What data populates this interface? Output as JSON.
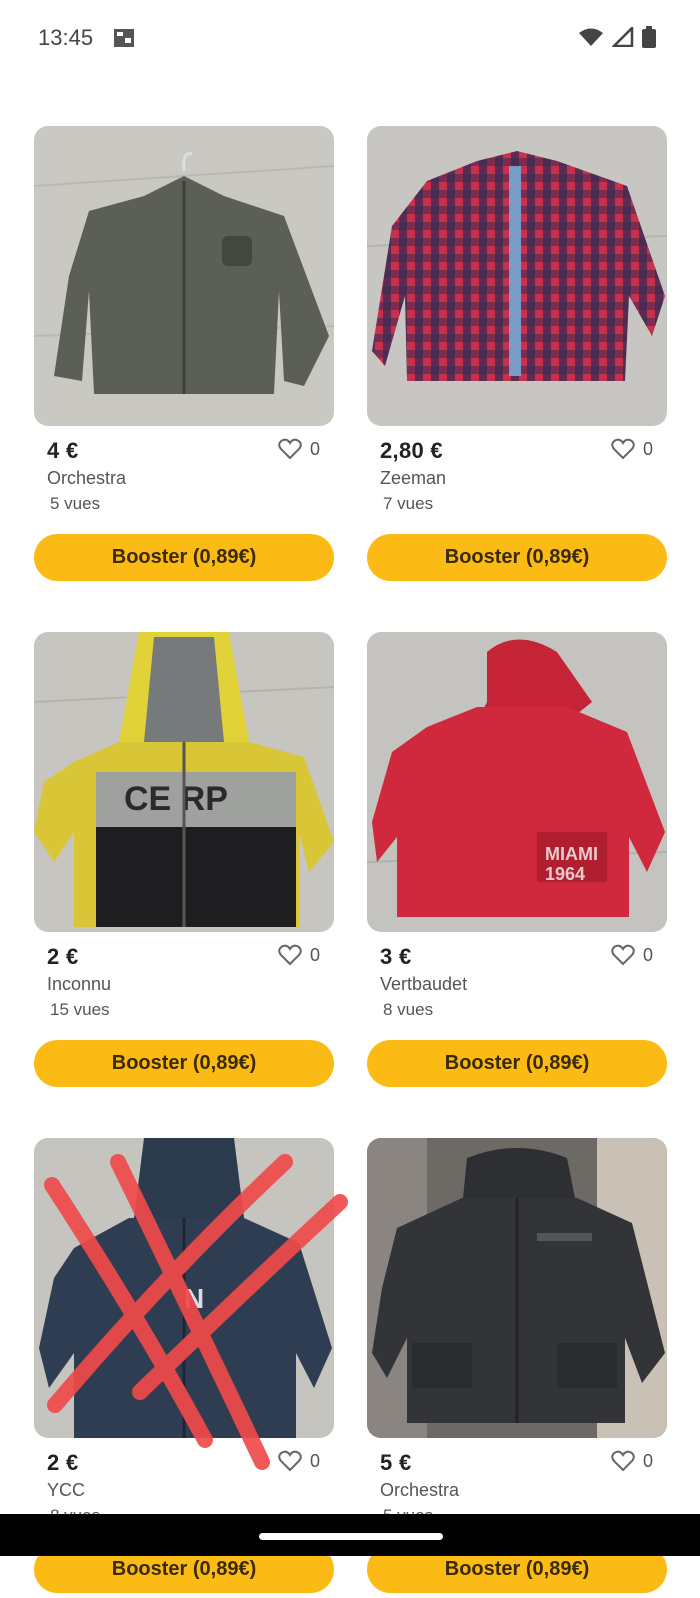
{
  "status": {
    "time": "13:45"
  },
  "products": [
    {
      "price": "4 €",
      "brand": "Orchestra",
      "views": "5 vues",
      "likes": "0",
      "boost_label": "Booster (0,89€)",
      "image": "olive-jacket"
    },
    {
      "price": "2,80 €",
      "brand": "Zeeman",
      "views": "7 vues",
      "likes": "0",
      "boost_label": "Booster (0,89€)",
      "image": "red-plaid-shirt"
    },
    {
      "price": "2 €",
      "brand": "Inconnu",
      "views": "15 vues",
      "likes": "0",
      "boost_label": "Booster (0,89€)",
      "image": "yellow-hoodie"
    },
    {
      "price": "3 €",
      "brand": "Vertbaudet",
      "views": "8 vues",
      "likes": "0",
      "boost_label": "Booster (0,89€)",
      "image": "red-anorak"
    },
    {
      "price": "2 €",
      "brand": "YCC",
      "views": "8 vues",
      "likes": "0",
      "boost_label": "Booster (0,89€)",
      "image": "navy-hoodie-crossed"
    },
    {
      "price": "5 €",
      "brand": "Orchestra",
      "views": "5 vues",
      "likes": "0",
      "boost_label": "Booster (0,89€)",
      "image": "black-parka"
    }
  ],
  "colors": {
    "boost": "#fbbb14",
    "cross_mark": "#f04a4a"
  }
}
